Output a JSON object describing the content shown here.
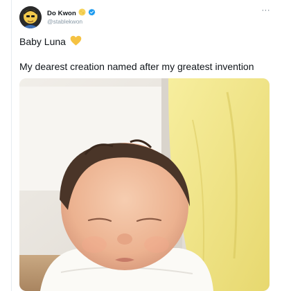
{
  "author": {
    "display_name": "Do Kwon",
    "handle": "@stablekwon",
    "avatar_icon": "avatar-cartoon-icon",
    "moon_emoji": "🌕",
    "verified_icon": "verified-badge-icon",
    "verified_color": "#1d9bf0"
  },
  "tweet": {
    "text_line1": "Baby Luna",
    "heart_emoji": "💛",
    "text_line2": "My dearest creation named after my greatest invention",
    "more_label": "···"
  },
  "media": {
    "type": "photo"
  },
  "colors": {
    "text": "#0f1419",
    "secondary": "#8899a6",
    "heart": "#f5c242"
  }
}
